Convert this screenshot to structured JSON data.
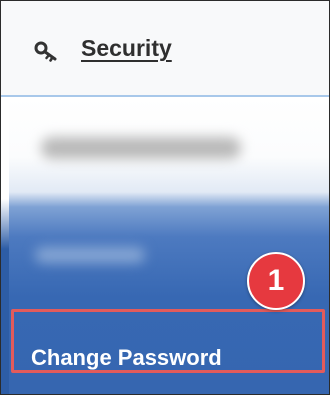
{
  "header": {
    "icon": "key-icon",
    "link_label": "Security"
  },
  "menu": {
    "obscured_items": [
      "blurred-item-1",
      "blurred-item-2"
    ],
    "active_item": {
      "label": "Change Password"
    }
  },
  "annotation": {
    "step_number": "1",
    "badge_color": "#e6393f",
    "highlight_color": "#e25b5b"
  },
  "colors": {
    "menu_blue": "#3666b0",
    "header_border": "#a8c8ea"
  }
}
